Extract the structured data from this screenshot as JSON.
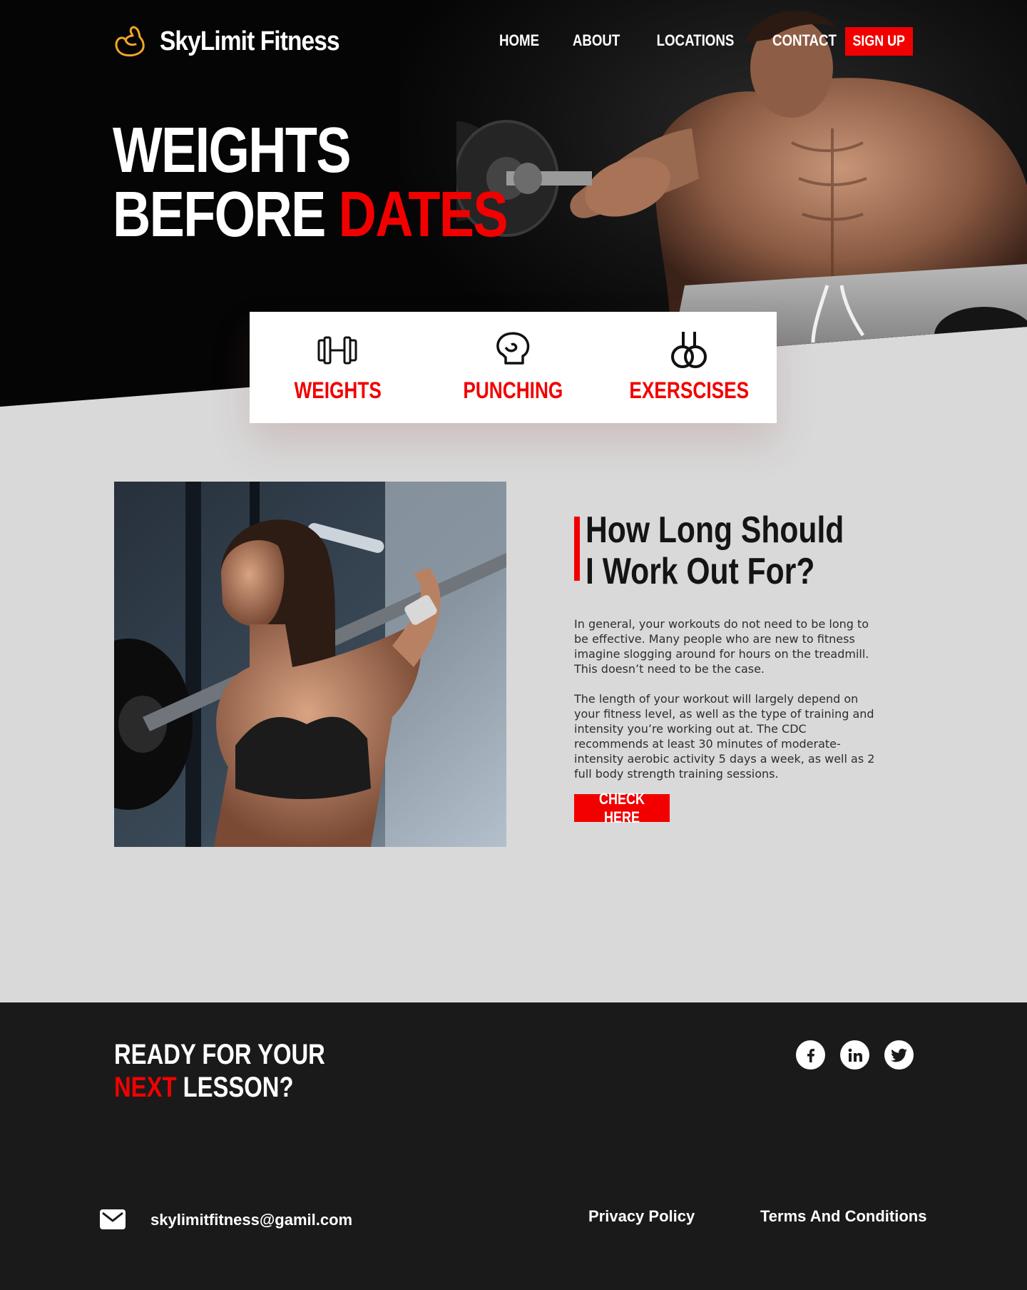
{
  "header": {
    "brand": "SkyLimit Fitness",
    "logo_icon": "flexed-arm-icon",
    "nav": [
      "HOME",
      "ABOUT",
      "LOCATIONS",
      "CONTACT"
    ],
    "signup_label": "SIGN UP"
  },
  "hero": {
    "line1": "WEIGHTS",
    "line2_white": "BEFORE",
    "line2_red": "DATES"
  },
  "categories": [
    {
      "label": "WEIGHTS",
      "icon": "dumbbell-icon"
    },
    {
      "label": "PUNCHING",
      "icon": "boxing-glove-icon"
    },
    {
      "label": "EXERSCISES",
      "icon": "gymnastic-rings-icon"
    }
  ],
  "article": {
    "title": "How Long Should I Work Out For?",
    "paragraph1": "In general, your workouts do not need to be long to be effective. Many people who are new to fitness imagine slogging around for hours on the treadmill. This doesn’t need to be the case.",
    "paragraph2": "The length of your workout will largely depend on your fitness level, as well as the type of training and intensity you’re working out at. The CDC recommends at least 30 minutes of moderate-intensity aerobic activity 5 days a week, as well as 2 full body strength training sessions.",
    "button_label": "CHECK HERE"
  },
  "footer": {
    "cta_line1": "READY FOR YOUR",
    "cta_red": "NEXT",
    "cta_rest": "LESSON?",
    "socials": [
      {
        "glyph": "f",
        "icon": "facebook-icon"
      },
      {
        "glyph": "in",
        "icon": "linkedin-icon"
      },
      {
        "glyph": "t",
        "icon": "twitter-icon"
      }
    ],
    "email": "skylimitfitness@gamil.com",
    "privacy": "Privacy Policy",
    "terms": "Terms And Conditions"
  },
  "colors": {
    "accent": "#f20000",
    "dark": "#1a1a1a",
    "light_bg": "#d9d9d9",
    "logo": "#f5a623"
  }
}
